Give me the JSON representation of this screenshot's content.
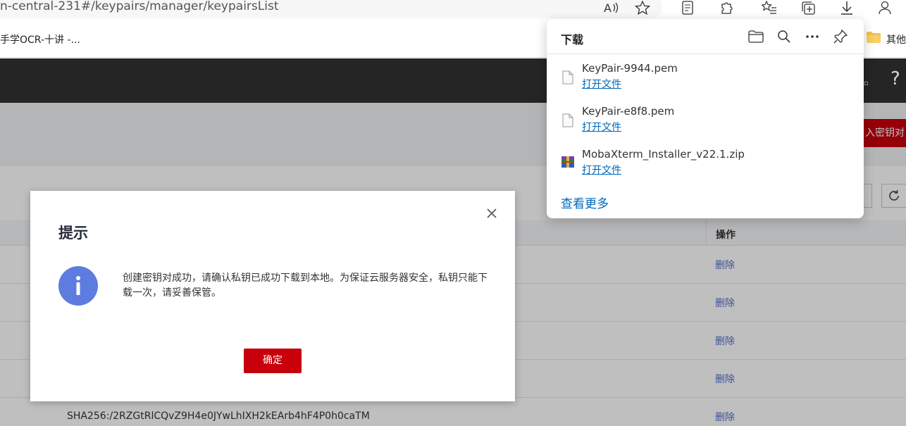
{
  "browser": {
    "url": "n-central-231#/keypairs/manager/keypairsList",
    "bookmark_text": "手学OCR-十讲 -...",
    "other_bookmarks": "其他"
  },
  "page": {
    "import_button": "入密钥对",
    "column_action": "操作",
    "delete_label": "删除",
    "last_row_fingerprint": "SHA256:/2RZGtRlCQvZ9H4e0JYwLhIXH2kEArb4hF4P0h0caTM",
    "rows": [
      {
        "delete": "删除"
      },
      {
        "delete": "删除"
      },
      {
        "delete": "删除"
      },
      {
        "delete": "删除"
      },
      {
        "delete": "删除"
      }
    ]
  },
  "dialog": {
    "title": "提示",
    "message": "创建密钥对成功，请确认私钥已成功下载到本地。为保证云服务器安全，私钥只能下载一次，请妥善保管。",
    "ok_button": "确定"
  },
  "downloads": {
    "title": "下载",
    "items": [
      {
        "name": "KeyPair-9944.pem",
        "action": "打开文件",
        "icon": "file-icon"
      },
      {
        "name": "KeyPair-e8f8.pem",
        "action": "打开文件",
        "icon": "file-icon"
      },
      {
        "name": "MobaXterm_Installer_v22.1.zip",
        "action": "打开文件",
        "icon": "winrar-archive-icon"
      }
    ],
    "see_more": "查看更多"
  },
  "colors": {
    "brand_red": "#c7000b",
    "info_blue": "#5e7ce0",
    "link_blue": "#0067b8",
    "table_link": "#526ecc"
  }
}
